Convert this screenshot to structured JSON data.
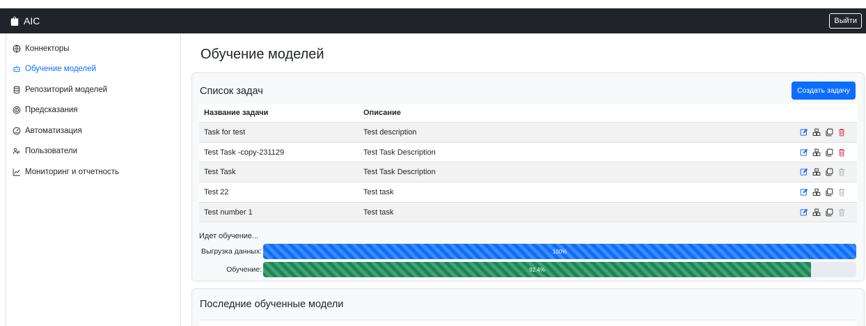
{
  "app": {
    "title": "AIC",
    "logout_label": "Выйти"
  },
  "sidebar": {
    "items": [
      {
        "label": "Коннекторы",
        "icon": "globe-icon",
        "active": false
      },
      {
        "label": "Обучение моделей",
        "icon": "robot-icon",
        "active": true
      },
      {
        "label": "Репозиторий моделей",
        "icon": "database-icon",
        "active": false
      },
      {
        "label": "Предсказания",
        "icon": "target-icon",
        "active": false
      },
      {
        "label": "Автоматизация",
        "icon": "gauge-icon",
        "active": false
      },
      {
        "label": "Пользователи",
        "icon": "users-icon",
        "active": false
      },
      {
        "label": "Мониторинг и отчетность",
        "icon": "chart-icon",
        "active": false
      }
    ]
  },
  "main": {
    "title": "Обучение моделей",
    "tasks": {
      "title": "Список задач",
      "create_label": "Создать задачу",
      "columns": {
        "name": "Название задачи",
        "description": "Описание"
      },
      "rows": [
        {
          "name": "Task for test",
          "description": "Test description",
          "delete_active": true
        },
        {
          "name": "Test Task -copy-231129",
          "description": "Test Task Description",
          "delete_active": true
        },
        {
          "name": "Test Task",
          "description": "Test Task Description",
          "delete_active": false
        },
        {
          "name": "Test 22",
          "description": "Test task",
          "delete_active": false
        },
        {
          "name": "Test number 1",
          "description": "Test task",
          "delete_active": false
        }
      ]
    },
    "progress": {
      "status": "Идет обучение...",
      "bars": [
        {
          "label": "Выгрузка данных:",
          "value": 100,
          "text": "100%",
          "color": "blue"
        },
        {
          "label": "Обучение:",
          "value": 92.4,
          "text": "92.4%",
          "color": "green"
        }
      ]
    },
    "models": {
      "title": "Последние обученные модели"
    }
  },
  "colors": {
    "primary": "#0d6efd",
    "success": "#198754",
    "danger": "#dc3545",
    "topbar": "#212529"
  }
}
